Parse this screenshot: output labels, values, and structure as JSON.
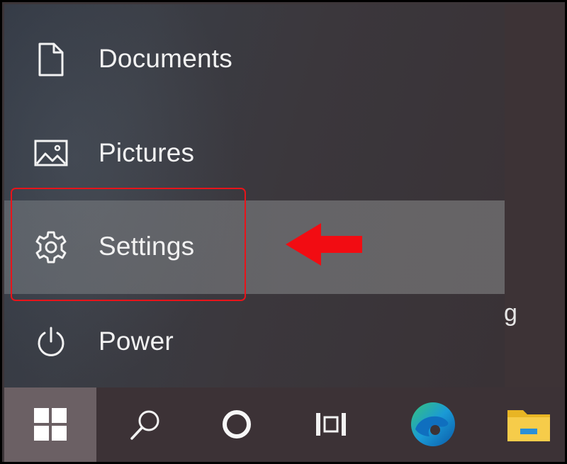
{
  "start_menu": {
    "items": [
      {
        "label": "Documents",
        "icon": "document-icon"
      },
      {
        "label": "Pictures",
        "icon": "pictures-icon"
      },
      {
        "label": "Settings",
        "icon": "gear-icon",
        "highlighted": true
      },
      {
        "label": "Power",
        "icon": "power-icon"
      }
    ]
  },
  "right_panel": {
    "partial_text": "g"
  },
  "annotation": {
    "box_color": "#e8141a",
    "arrow_color": "#e8141a",
    "arrow_target": "Settings"
  },
  "taskbar": {
    "buttons": [
      {
        "name": "start",
        "icon": "windows-logo-icon"
      },
      {
        "name": "search",
        "icon": "search-icon"
      },
      {
        "name": "cortana",
        "icon": "cortana-icon"
      },
      {
        "name": "task-view",
        "icon": "task-view-icon"
      },
      {
        "name": "edge",
        "icon": "edge-icon"
      },
      {
        "name": "file-explorer",
        "icon": "file-explorer-icon"
      }
    ]
  }
}
